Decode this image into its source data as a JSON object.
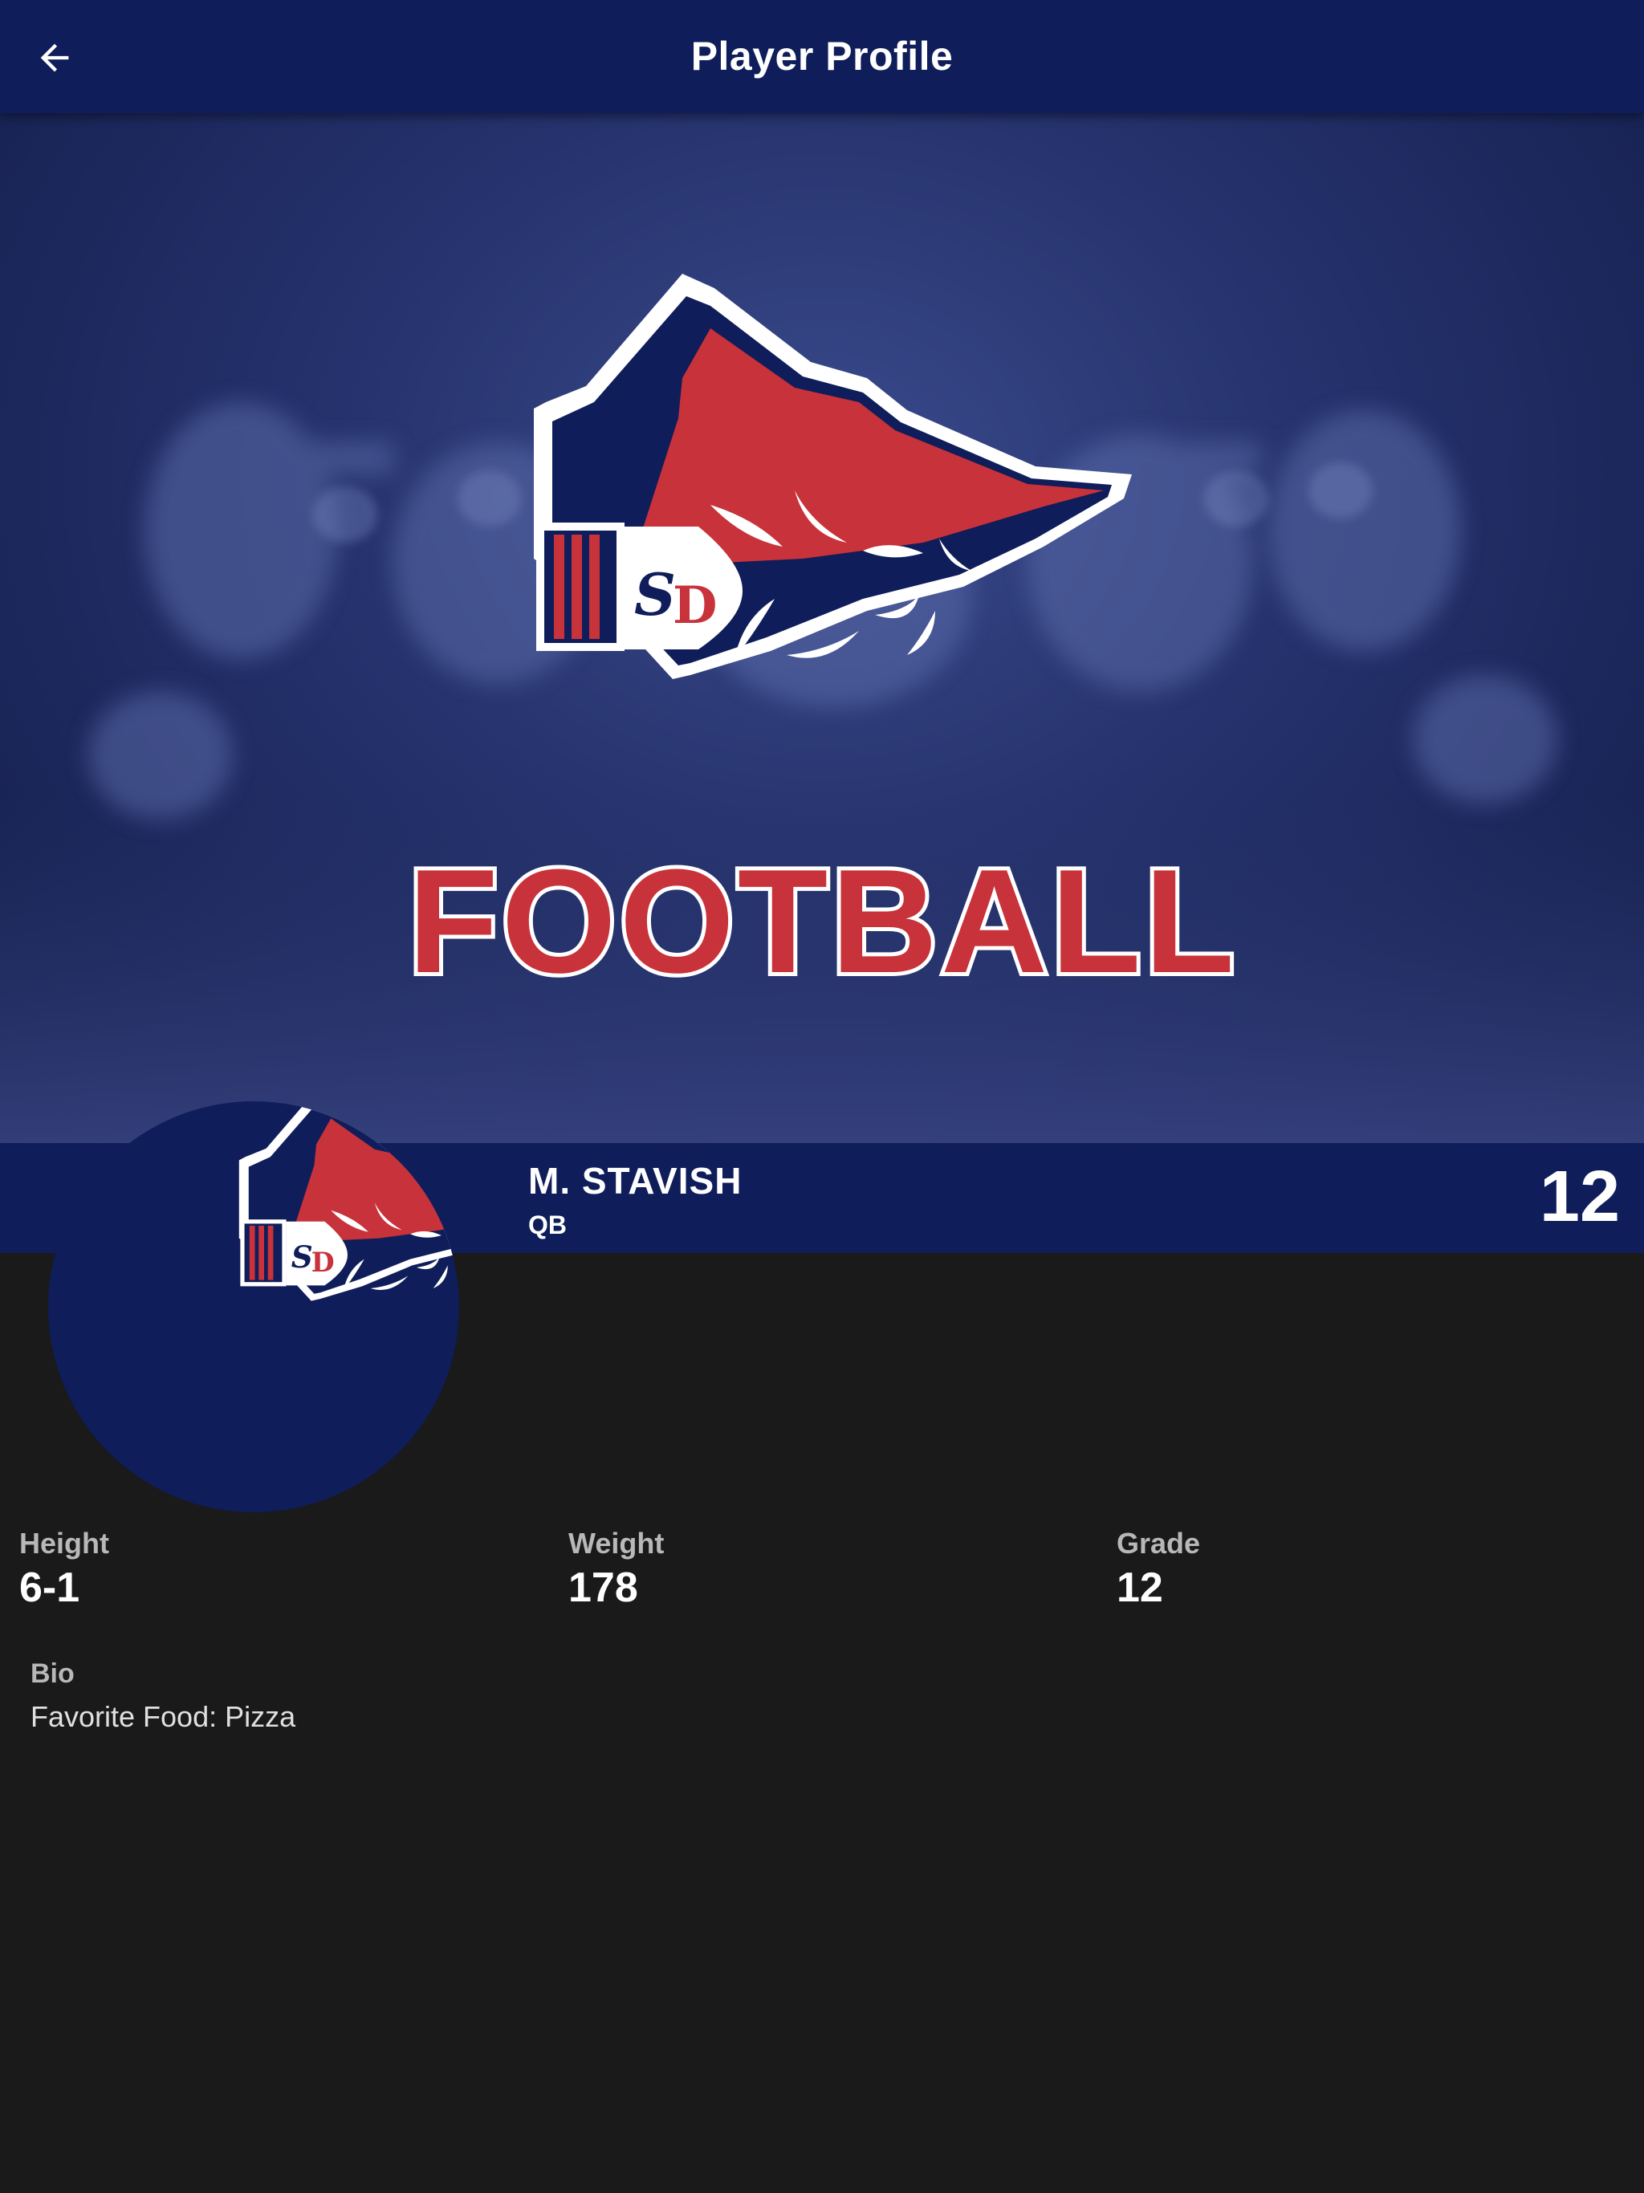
{
  "header": {
    "title": "Player Profile",
    "back_icon": "arrow-left-icon"
  },
  "hero": {
    "wordmark": "FOOTBALL",
    "logo_monogram": "SD",
    "logo_icon": "arrowhead-logo"
  },
  "player": {
    "name": "M. STAVISH",
    "position": "QB",
    "number": "12"
  },
  "stats": [
    {
      "label": "Height",
      "value": "6-1"
    },
    {
      "label": "Weight",
      "value": "178"
    },
    {
      "label": "Grade",
      "value": "12"
    }
  ],
  "bio": {
    "label": "Bio",
    "text": "Favorite Food: Pizza"
  },
  "colors": {
    "navy": "#0f1d5a",
    "red": "#c8323a",
    "background": "#1a1a1a"
  }
}
